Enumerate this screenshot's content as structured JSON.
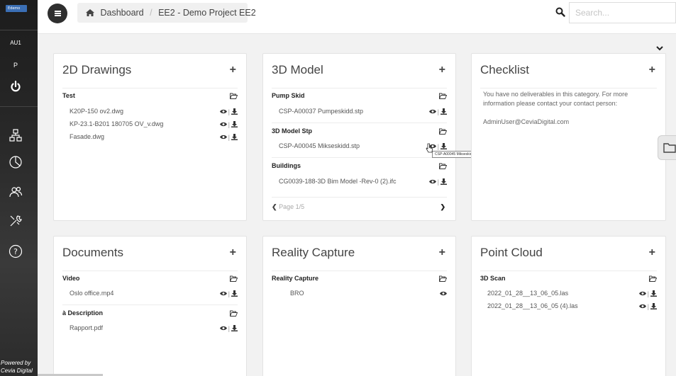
{
  "sidebar": {
    "logo_text": "Edemo",
    "user_initials": "AU1",
    "project_initial": "P",
    "icons": [
      "power-icon",
      "sitemap-icon",
      "pie-chart-icon",
      "users-icon",
      "tools-icon",
      "help-icon"
    ],
    "powered_line1": "Powered by",
    "powered_line2": "Cevia Digital"
  },
  "topbar": {
    "breadcrumb_home": "Dashboard",
    "breadcrumb_sep": "/",
    "breadcrumb_project": "EE2 - Demo Project EE2",
    "search_placeholder": "Search..."
  },
  "cards": {
    "drawings": {
      "title": "2D Drawings",
      "add": "+",
      "categories": [
        {
          "name": "Test",
          "files": [
            "K20P-150 ov2.dwg",
            "KP-23.1-B201 180705 OV_v.dwg",
            "Fasade.dwg"
          ]
        }
      ]
    },
    "model": {
      "title": "3D Model",
      "add": "+",
      "categories": [
        {
          "name": "Pump Skid",
          "files": [
            "CSP-A00037 Pumpeskidd.stp"
          ]
        },
        {
          "name": "3D Model Stp",
          "files": [
            "CSP-A00045 Mikseskidd.stp"
          ]
        },
        {
          "name": "Buildings",
          "files": [
            "CG0039-188-3D Bim Model -Rev-0 (2).ifc"
          ]
        }
      ],
      "pager": "Page 1/5",
      "tooltip": "CSP-A00045 Mikseskidd.stp"
    },
    "checklist": {
      "title": "Checklist",
      "add": "+",
      "message": "You have no deliverables in this category. For more information please contact your contact person:",
      "contact": "AdminUser@CeviaDigital.com"
    },
    "documents": {
      "title": "Documents",
      "add": "+",
      "categories": [
        {
          "name": "Video",
          "files": [
            "Oslo office.mp4"
          ]
        },
        {
          "name": "à Description",
          "files": [
            "Rapport.pdf"
          ]
        }
      ]
    },
    "reality": {
      "title": "Reality Capture",
      "add": "+",
      "categories": [
        {
          "name": "Reality Capture",
          "files": [
            "BRO"
          ]
        }
      ]
    },
    "pointcloud": {
      "title": "Point Cloud",
      "add": "+",
      "categories": [
        {
          "name": "3D Scan",
          "files": [
            "2022_01_28__13_06_05.las",
            "2022_01_28__13_06_05 (4).las"
          ]
        }
      ]
    }
  },
  "colors": {
    "sidebar_bg": "#2a2a2a",
    "logo_blue": "#3b6fb5",
    "page_bg": "#f2f2f2"
  }
}
